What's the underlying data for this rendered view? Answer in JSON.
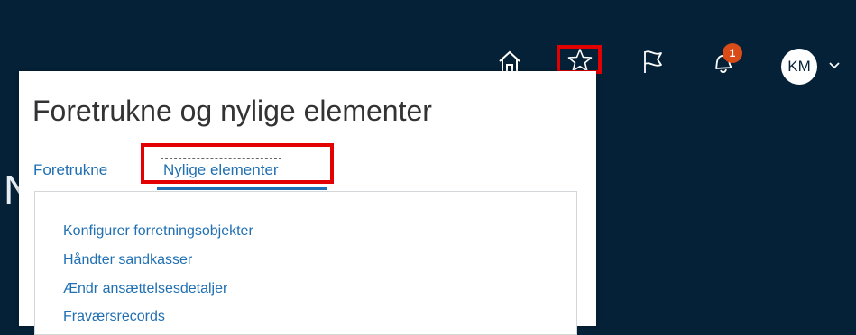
{
  "header": {
    "icons": [
      "home-icon",
      "star-icon",
      "flag-icon",
      "bell-icon"
    ],
    "notification_count": "1",
    "avatar_initials": "KM"
  },
  "background": {
    "partial_text": "N"
  },
  "panel": {
    "title": "Foretrukne og nylige elementer",
    "tabs": [
      {
        "label": "Foretrukne",
        "selected": false
      },
      {
        "label": "Nylige elementer",
        "selected": true
      }
    ],
    "recent_items": [
      "Konfigurer forretningsobjekter",
      "Håndter sandkasser",
      "Ændr ansættelsesdetaljer",
      "Fraværsrecords"
    ]
  },
  "colors": {
    "app_background": "#052137",
    "link": "#1f6fb2",
    "highlight": "#e20000",
    "badge": "#d94b17"
  }
}
